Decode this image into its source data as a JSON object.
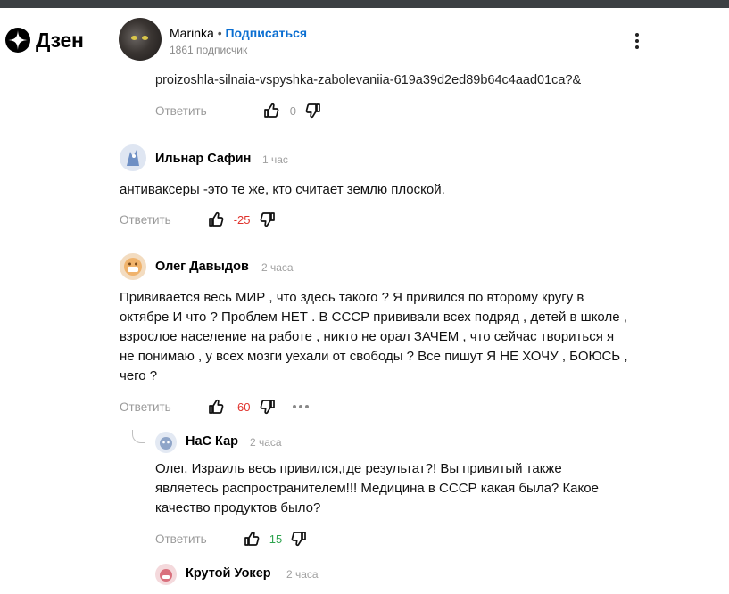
{
  "app": {
    "logo_text": "Дзен"
  },
  "channel": {
    "name": "Marinka",
    "separator": "•",
    "subscribe_label": "Подписаться",
    "subscribers": "1861 подписчик"
  },
  "prev_comment": {
    "url_tail": "proizoshla-silnaia-vspyshka-zabolevaniia-619a39d2ed89b64c4aad01ca?&",
    "reply_label": "Ответить",
    "likes": "0"
  },
  "comments": [
    {
      "author": "Ильнар Сафин",
      "time": "1 час",
      "text": "антиваксеры -это те же, кто считает землю плоской.",
      "reply_label": "Ответить",
      "likes": "-25"
    },
    {
      "author": "Олег Давыдов",
      "time": "2 часа",
      "lines": [
        "Прививается весь МИР , что здесь такого ? Я привился по второму кругу в",
        "октябре И что ? Проблем НЕТ . В СССР прививали всех подряд , детей в школе ,",
        "взрослое население на работе , никто не орал ЗАЧЕМ , что сейчас твориться я",
        "не понимаю , у всех мозги уехали от свободы ? Все пишут Я НЕ ХОЧУ , БОЮСЬ ,",
        "чего ?"
      ],
      "reply_label": "Ответить",
      "likes": "-60"
    }
  ],
  "replies": [
    {
      "author": "НаС Кар",
      "time": "2 часа",
      "lines": [
        "Олег, Израиль весь привился,где результат?! Вы привитый также",
        "являетесь распространителем!!! Медицина в СССР какая была? Какое",
        "качество продуктов было?"
      ],
      "reply_label": "Ответить",
      "likes": "15"
    },
    {
      "author": "Крутой Уокер",
      "time": "2 часа"
    }
  ],
  "icons": {
    "logo": "zen-star-icon",
    "kebab": "kebab-menu-icon",
    "like": "thumbs-up-icon",
    "dislike": "thumbs-down-icon",
    "more": "more-dots-icon"
  },
  "colors": {
    "subscribe": "#0a6ed1",
    "negative": "#e0322c",
    "positive": "#2ea44f",
    "muted": "#9a9a9a"
  }
}
